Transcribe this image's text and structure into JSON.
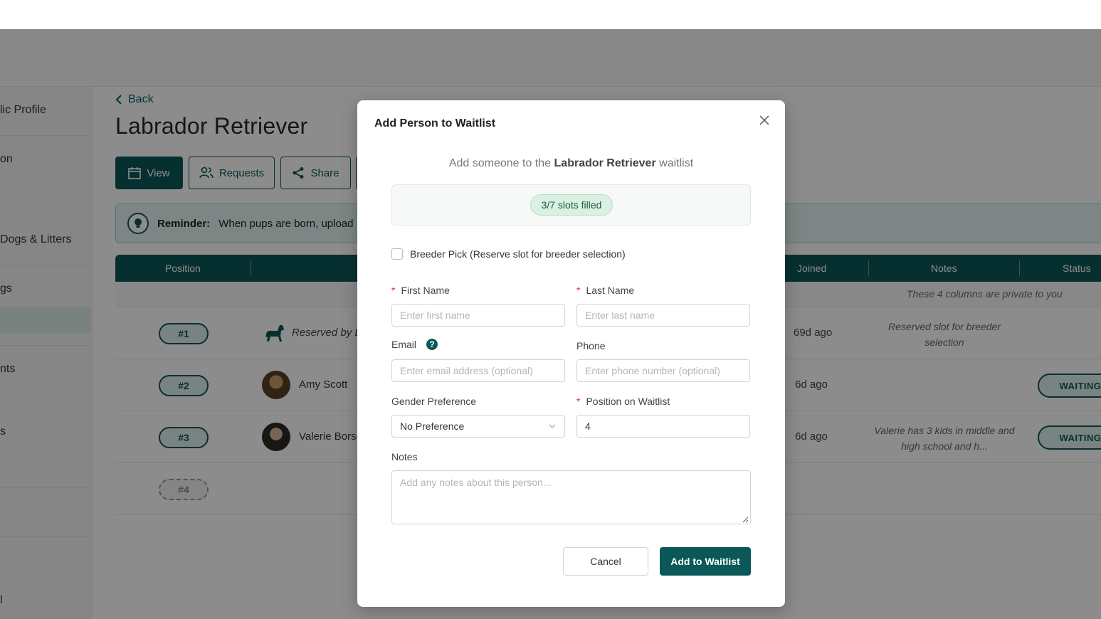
{
  "sidebar": {
    "items": [
      {
        "label": "lic Profile"
      },
      {
        "label": "on"
      },
      {
        "label": "Dogs & Litters"
      },
      {
        "label": "gs"
      },
      {
        "label": "nts"
      },
      {
        "label": "s"
      },
      {
        "label": "l"
      }
    ]
  },
  "page": {
    "back_label": "Back",
    "title": "Labrador Retriever",
    "buttons": {
      "view": "View",
      "requests": "Requests",
      "share": "Share"
    },
    "reminder": {
      "label": "Reminder:",
      "text": "When pups are born, upload"
    }
  },
  "table": {
    "headers": {
      "position": "Position",
      "joined": "Joined",
      "notes": "Notes",
      "status": "Status"
    },
    "private_note": "These 4 columns are private to you",
    "rows": [
      {
        "position": "#1",
        "name": "Reserved by Br",
        "joined": "69d ago",
        "notes": "Reserved slot for breeder selection",
        "status": ""
      },
      {
        "position": "#2",
        "name": "Amy Scott",
        "joined": "6d ago",
        "notes": "",
        "status": "WAITING"
      },
      {
        "position": "#3",
        "name": "Valerie Borse",
        "joined": "6d ago",
        "notes": "Valerie has 3 kids in middle and high school and h...",
        "status": "WAITING"
      },
      {
        "position": "#4",
        "name": "",
        "joined": "",
        "notes": "",
        "status": ""
      }
    ]
  },
  "modal": {
    "title": "Add Person to Waitlist",
    "subtitle_prefix": "Add someone to the",
    "subtitle_breed": "Labrador Retriever",
    "subtitle_suffix": "waitlist",
    "slots_label": "3/7 slots filled",
    "breeder_pick_label": "Breeder Pick (Reserve slot for breeder selection)",
    "required_mark": "*",
    "first_name": {
      "label": "First Name",
      "placeholder": "Enter first name",
      "value": ""
    },
    "last_name": {
      "label": "Last Name",
      "placeholder": "Enter last name",
      "value": ""
    },
    "email": {
      "label": "Email",
      "placeholder": "Enter email address (optional)",
      "value": ""
    },
    "phone": {
      "label": "Phone",
      "placeholder": "Enter phone number (optional)",
      "value": ""
    },
    "gender": {
      "label": "Gender Preference",
      "value": "No Preference"
    },
    "position": {
      "label": "Position on Waitlist",
      "value": "4"
    },
    "notes": {
      "label": "Notes",
      "placeholder": "Add any notes about this person..."
    },
    "cancel_label": "Cancel",
    "submit_label": "Add to Waitlist",
    "help_glyph": "?"
  },
  "colors": {
    "brand": "#0b5858",
    "required": "#d9363e",
    "slots_bg": "#d9f0e2"
  }
}
